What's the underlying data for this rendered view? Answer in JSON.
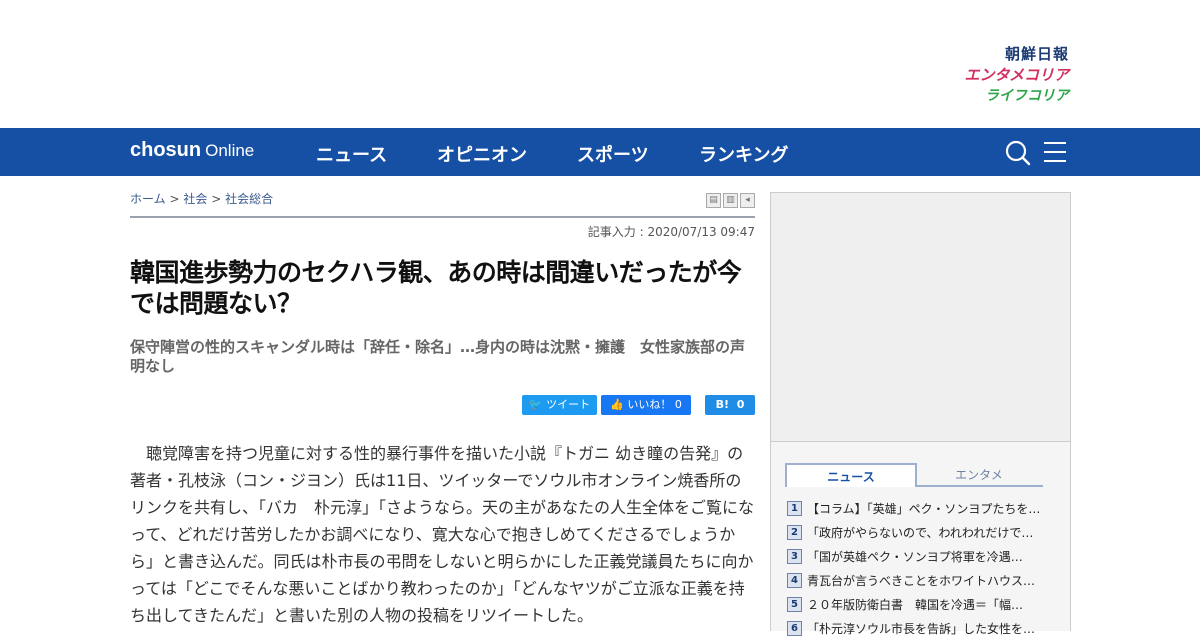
{
  "header": {
    "logo_chosun": "朝鮮日報",
    "logo_entame": "エンタメコリア",
    "logo_life": "ライフコリア"
  },
  "nav": {
    "brand_bold": "chosun",
    "brand_light": "Online",
    "items": [
      "ニュース",
      "オピニオン",
      "スポーツ",
      "ランキング"
    ]
  },
  "breadcrumb": {
    "home": "ホーム",
    "sep": ">",
    "section": "社会",
    "subsection": "社会総合"
  },
  "article": {
    "dateline": "記事入力 : 2020/07/13 09:47",
    "title": "韓国進歩勢力のセクハラ観、あの時は間違いだったが今では問題ない？",
    "subtitle": "保守陣営の性的スキャンダル時は「辞任・除名」…身内の時は沈黙・擁護　女性家族部の声明なし",
    "body": "聴覚障害を持つ児童に対する性的暴行事件を描いた小説『トガニ 幼き瞳の告発』の著者・孔枝泳（コン・ジヨン）氏は11日、ツイッターでソウル市オンライン焼香所のリンクを共有し、「バカ　朴元淳」「さようなら。天の主があなたの人生全体をご覧になって、どれだけ苦労したかお調べになり、寛大な心で抱きしめてくださるでしょうから」と書き込んだ。同氏は朴市長の弔問をしないと明らかにした正義党議員たちに向かっては「どこでそんな悪いことばかり教わったのか」「どんなヤツがご立派な正義を持ち出してきたんだ」と書いた別の人物の投稿をリツイートした。"
  },
  "share": {
    "tweet": "ツイート",
    "like": "いいね！",
    "like_count": "0",
    "hatena": "B!",
    "hatena_count": "0"
  },
  "sidebar": {
    "tab_news": "ニュース",
    "tab_entame": "エンタメ",
    "ranking": [
      {
        "num": "1",
        "text": "【コラム】「英雄」ペク・ソンヨプたちを…"
      },
      {
        "num": "2",
        "text": "「政府がやらないので、われわれだけで…"
      },
      {
        "num": "3",
        "text": "「国が英雄ペク・ソンヨプ将軍を冷遇…"
      },
      {
        "num": "4",
        "text": "青瓦台が言うべきことをホワイトハウス…"
      },
      {
        "num": "5",
        "text": "２０年版防衛白書　韓国を冷遇＝「幅…"
      },
      {
        "num": "6",
        "text": "「朴元淳ソウル市長を告訴」した女性を…"
      }
    ]
  },
  "colors": {
    "nav_bg": "#1650a4",
    "entame_logo": "#d22f5e",
    "life_logo": "#2fa54a"
  }
}
